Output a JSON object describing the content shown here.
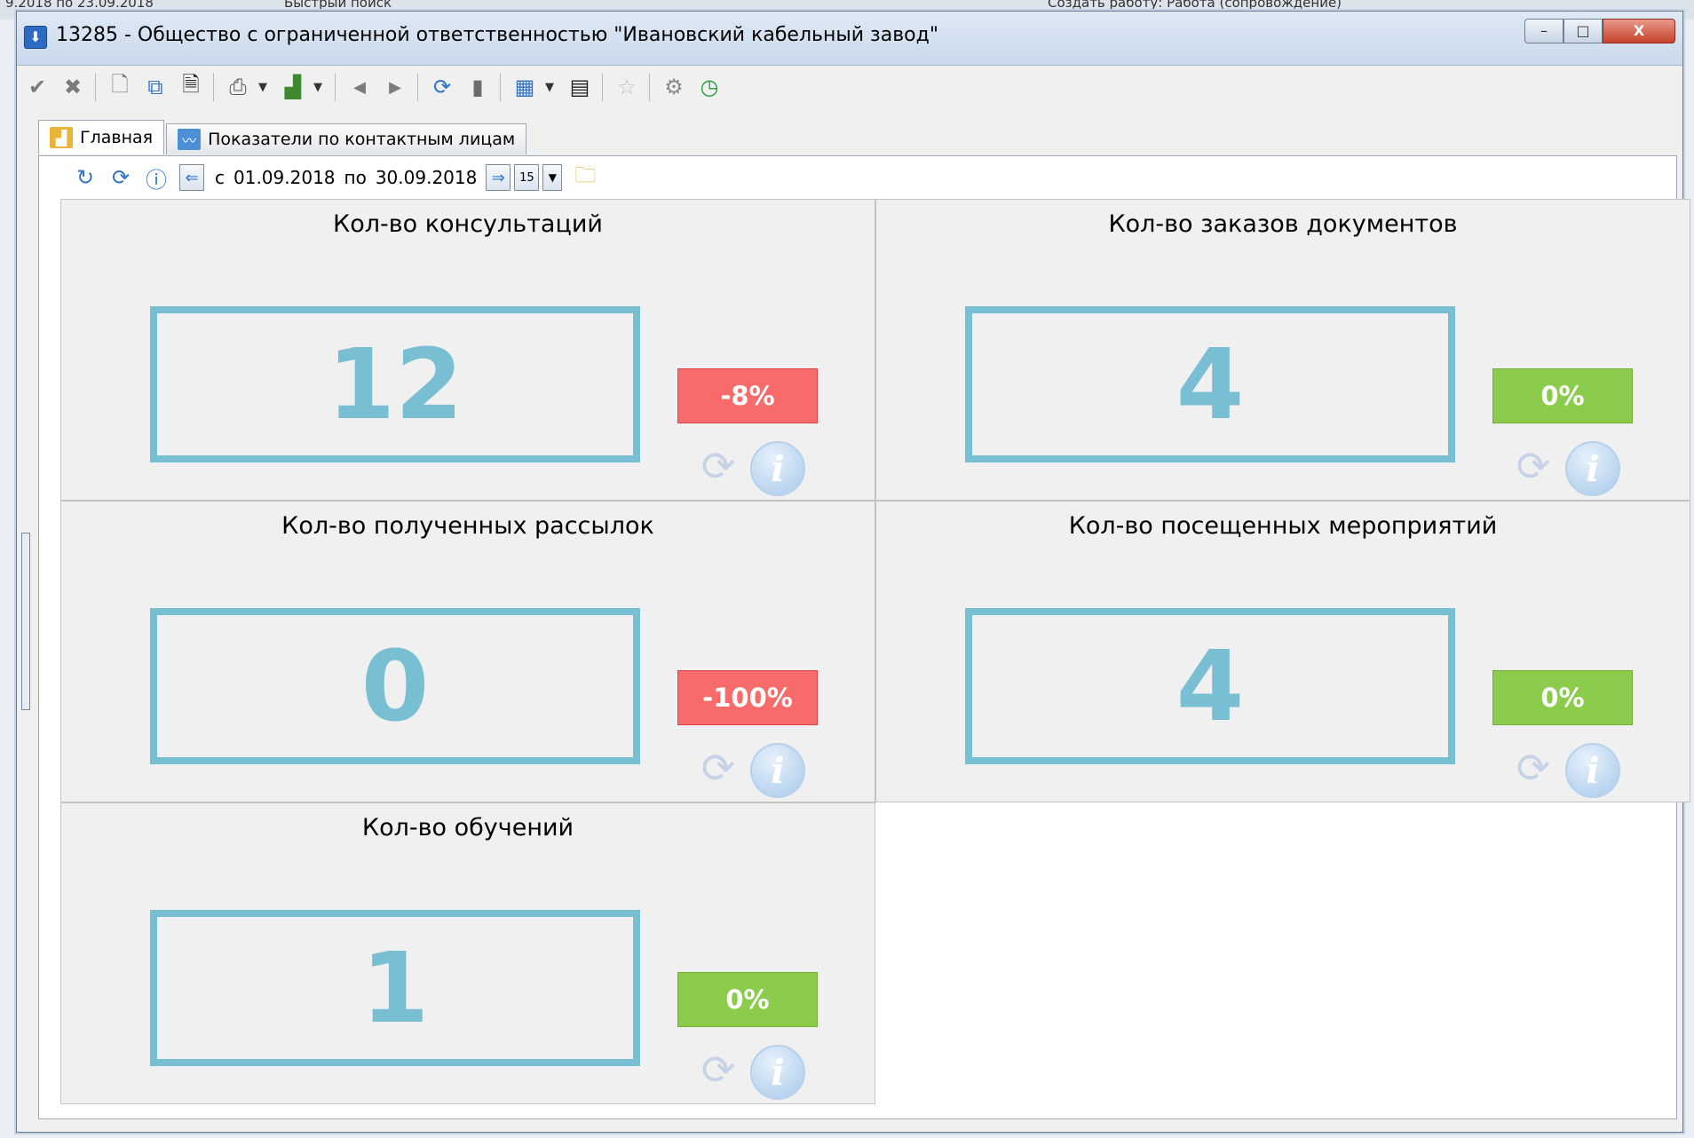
{
  "background_strip": {
    "left_text": "9.2018 по 23.09.2018",
    "quick_search": "Быстрый поиск",
    "right_text": "Создать работу: Работа (сопровождение)"
  },
  "window": {
    "title": "13285  -  Общество с ограниченной ответственностью \"Ивановский кабельный завод\"",
    "buttons": {
      "minimize": "–",
      "maximize": "□",
      "close": "X"
    }
  },
  "toolbar": {
    "icons": [
      "check-icon",
      "cross-icon",
      "new-document-icon",
      "copy-document-icon",
      "document-icon",
      "print-icon",
      "chart-icon",
      "arrow-left-icon",
      "arrow-right-icon",
      "refresh-icon",
      "bookmark-icon",
      "table-icon",
      "report-icon",
      "star-icon",
      "gear-icon",
      "clock-icon"
    ]
  },
  "tabs": [
    {
      "label": "Главная",
      "active": true,
      "icon": "chart-icon"
    },
    {
      "label": "Показатели по контактным лицам",
      "active": false,
      "icon": "line-chart-icon"
    }
  ],
  "period": {
    "from_label": "с",
    "from_date": "01.09.2018",
    "to_label": "по",
    "to_date": "30.09.2018",
    "calendar_day": "15"
  },
  "cards": [
    {
      "title": "Кол-во консультаций",
      "value": "12",
      "change": "-8%",
      "status": "negative"
    },
    {
      "title": "Кол-во заказов документов",
      "value": "4",
      "change": "0%",
      "status": "neutral"
    },
    {
      "title": "Кол-во полученных рассылок",
      "value": "0",
      "change": "-100%",
      "status": "negative"
    },
    {
      "title": "Кол-во посещенных мероприятий",
      "value": "4",
      "change": "0%",
      "status": "neutral"
    },
    {
      "title": "Кол-во обучений",
      "value": "1",
      "change": "0%",
      "status": "neutral"
    }
  ],
  "colors": {
    "value_blue": "#79bfd3",
    "badge_red": "#f76b6b",
    "badge_green": "#8ccc4c",
    "title_bar": "#c9d9ec"
  }
}
